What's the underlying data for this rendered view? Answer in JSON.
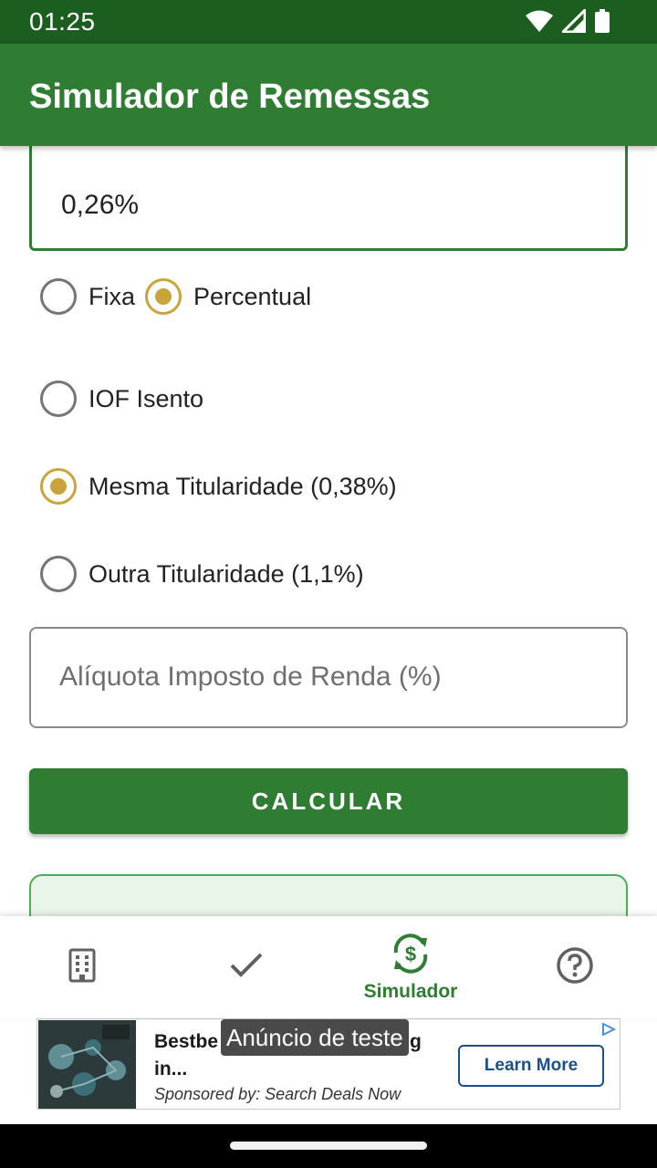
{
  "status_bar": {
    "time": "01:25",
    "icons": [
      "wifi-icon",
      "signal-icon",
      "battery-icon"
    ]
  },
  "app_bar": {
    "title": "Simulador de Remessas"
  },
  "form": {
    "fee_value": "0,26%",
    "fee_type_options": [
      {
        "label": "Fixa",
        "checked": false
      },
      {
        "label": "Percentual",
        "checked": true
      }
    ],
    "iof_options": [
      {
        "label": "IOF Isento",
        "checked": false
      },
      {
        "label": "Mesma Titularidade (0,38%)",
        "checked": true
      },
      {
        "label": "Outra Titularidade (1,1%)",
        "checked": false
      }
    ],
    "income_tax_placeholder": "Alíquota Imposto de Renda (%)",
    "calculate_label": "CALCULAR"
  },
  "bottom_nav": {
    "items": [
      {
        "icon": "building-icon",
        "label": "",
        "active": false
      },
      {
        "icon": "check-icon",
        "label": "",
        "active": false
      },
      {
        "icon": "currency-exchange-icon",
        "label": "Simulador",
        "active": true
      },
      {
        "icon": "help-icon",
        "label": "",
        "active": false
      }
    ]
  },
  "ad": {
    "overlay_label": "Anúncio de teste",
    "title": "Bestbe Management-Training in...",
    "sponsor": "Sponsored by: Search Deals Now",
    "cta": "Learn More",
    "choices_icon": "ad-choices-icon"
  },
  "colors": {
    "primary": "#2e7d32",
    "primary_dark": "#1b5e20",
    "accent": "#c9a43a"
  }
}
